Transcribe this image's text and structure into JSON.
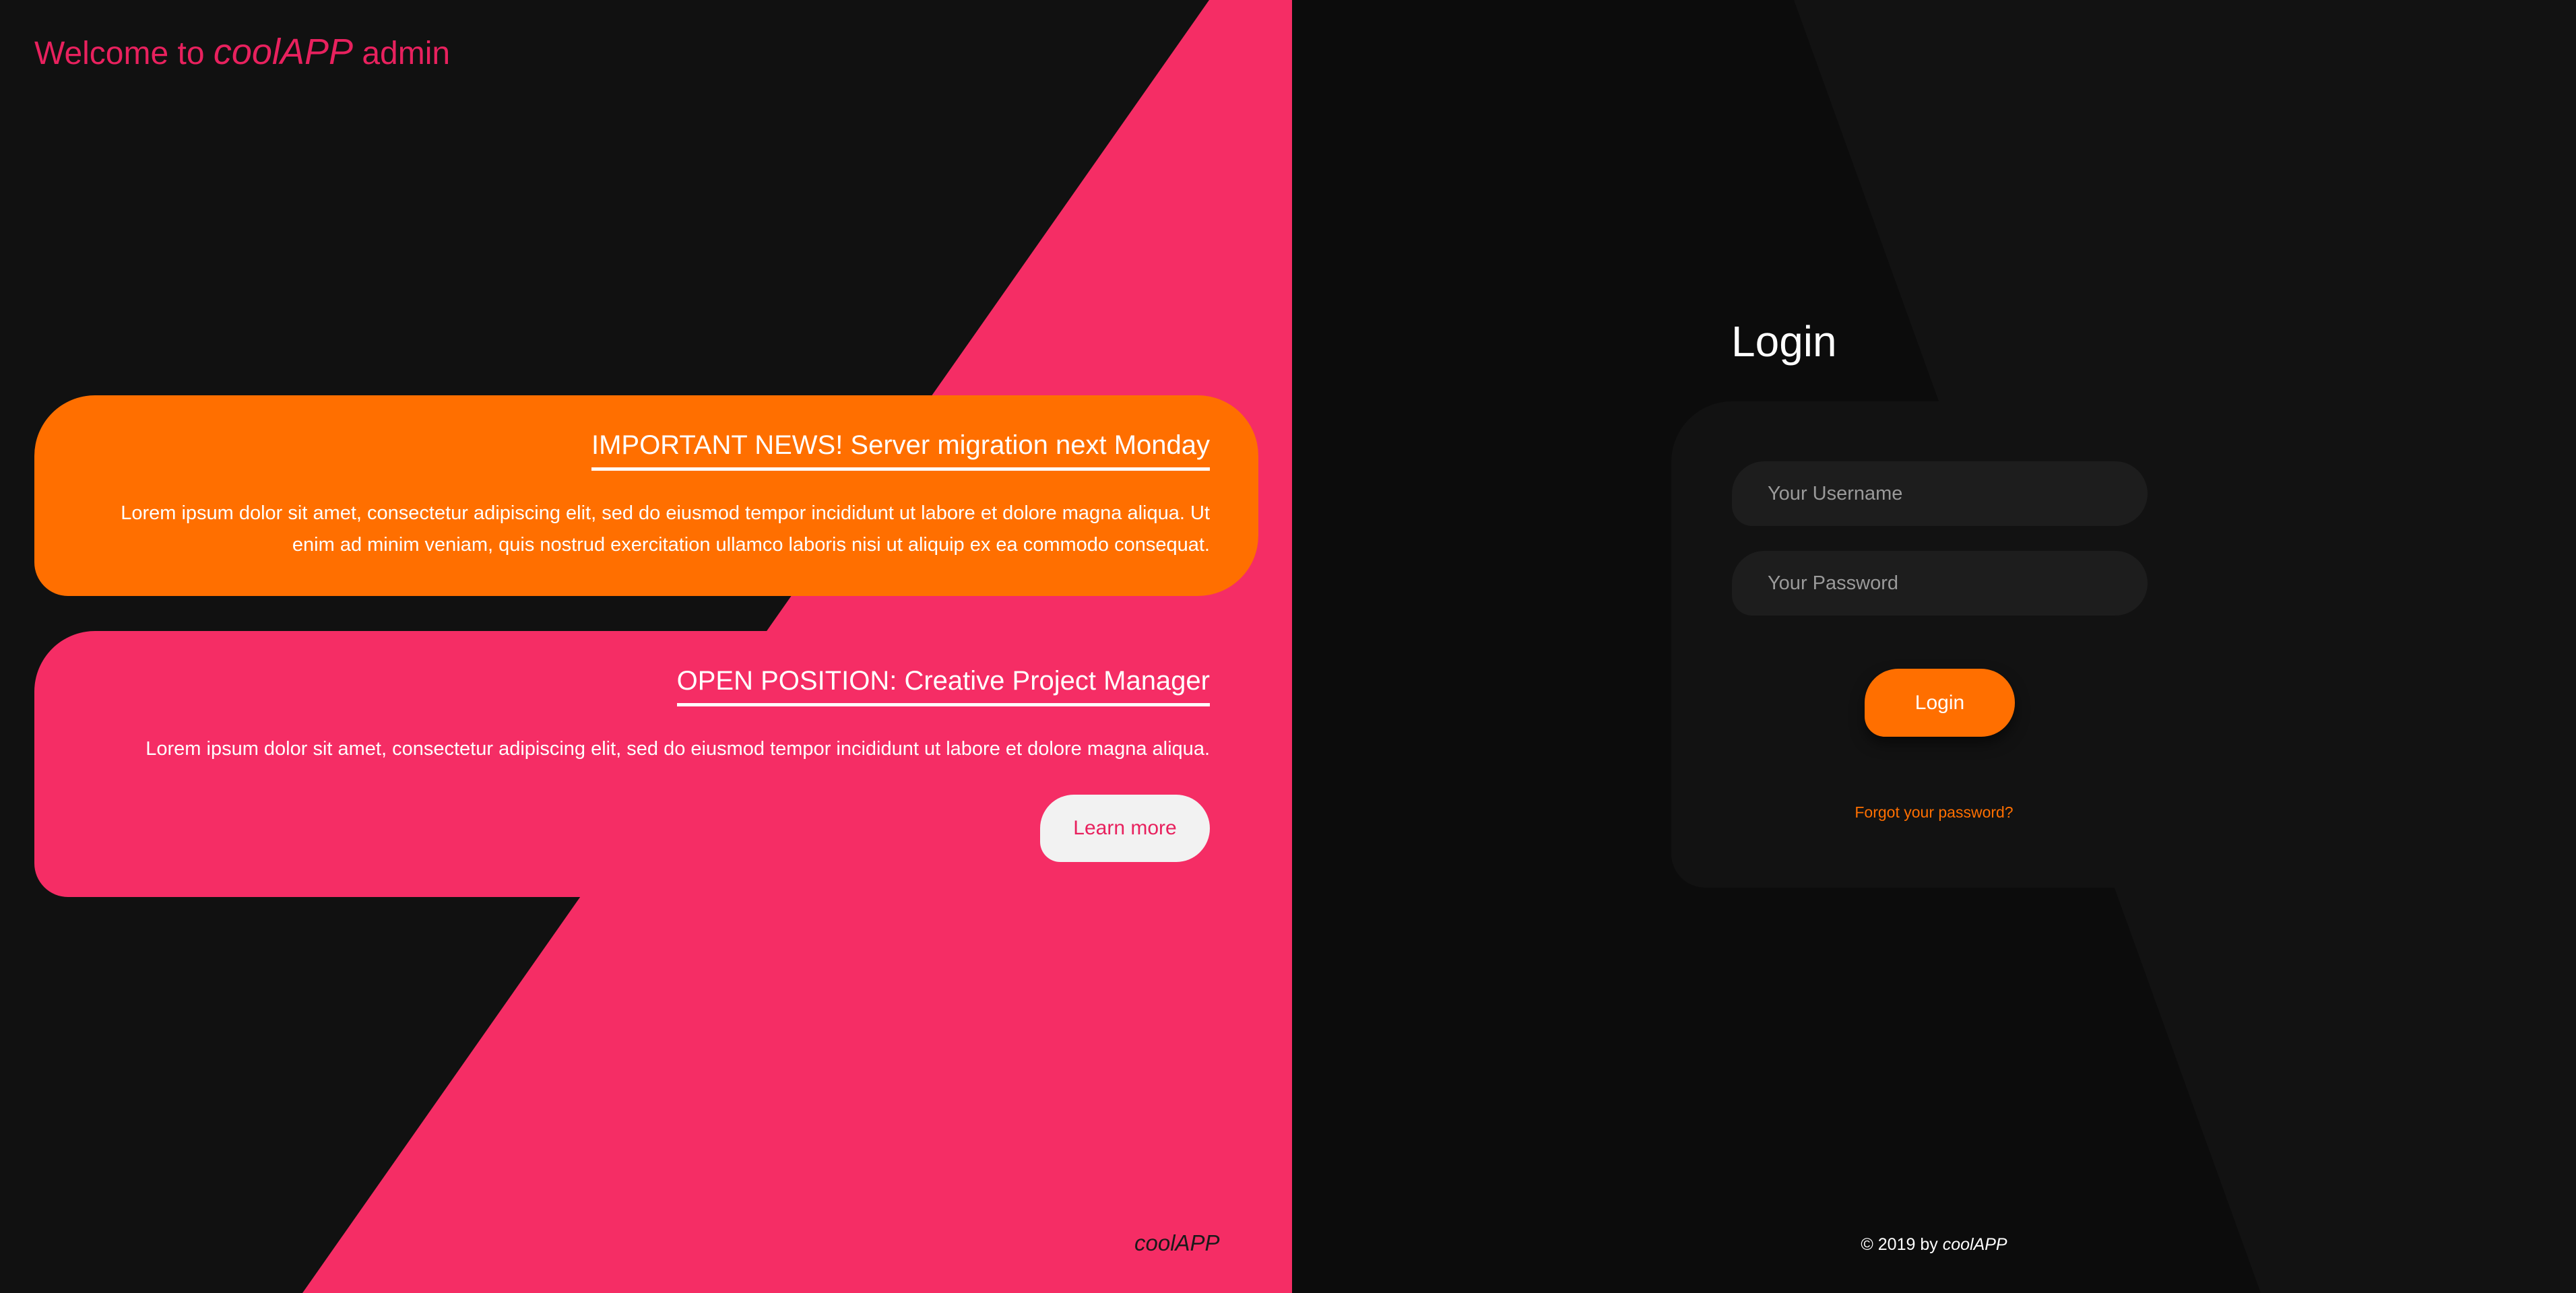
{
  "colors": {
    "accent_orange": "#ff6f00",
    "accent_pink": "#f52d65",
    "brand_red": "#e8215e",
    "background_dark": "#111111",
    "panel_dark": "#0c0c0c"
  },
  "header": {
    "welcome_prefix": "Welcome to",
    "brand": "coolAPP",
    "welcome_suffix": "admin"
  },
  "news": {
    "title": "IMPORTANT NEWS! Server migration next Monday",
    "body": "Lorem ipsum dolor sit amet, consectetur adipiscing elit, sed do eiusmod tempor incididunt ut labore et dolore magna aliqua. Ut enim ad minim veniam, quis nostrud exercitation ullamco laboris nisi ut aliquip ex ea commodo consequat."
  },
  "job": {
    "title": "OPEN POSITION: Creative Project Manager",
    "body": "Lorem ipsum dolor sit amet, consectetur adipiscing elit, sed do eiusmod tempor incididunt ut labore et dolore magna aliqua.",
    "button_label": "Learn more"
  },
  "left_footer": {
    "brand": "coolAPP"
  },
  "login": {
    "heading": "Login",
    "username_placeholder": "Your Username",
    "username_value": "",
    "password_placeholder": "Your Password",
    "password_value": "",
    "button_label": "Login",
    "forgot_label": "Forgot your password?"
  },
  "footer": {
    "copyright_prefix": "© 2019 by",
    "brand": "coolAPP"
  }
}
